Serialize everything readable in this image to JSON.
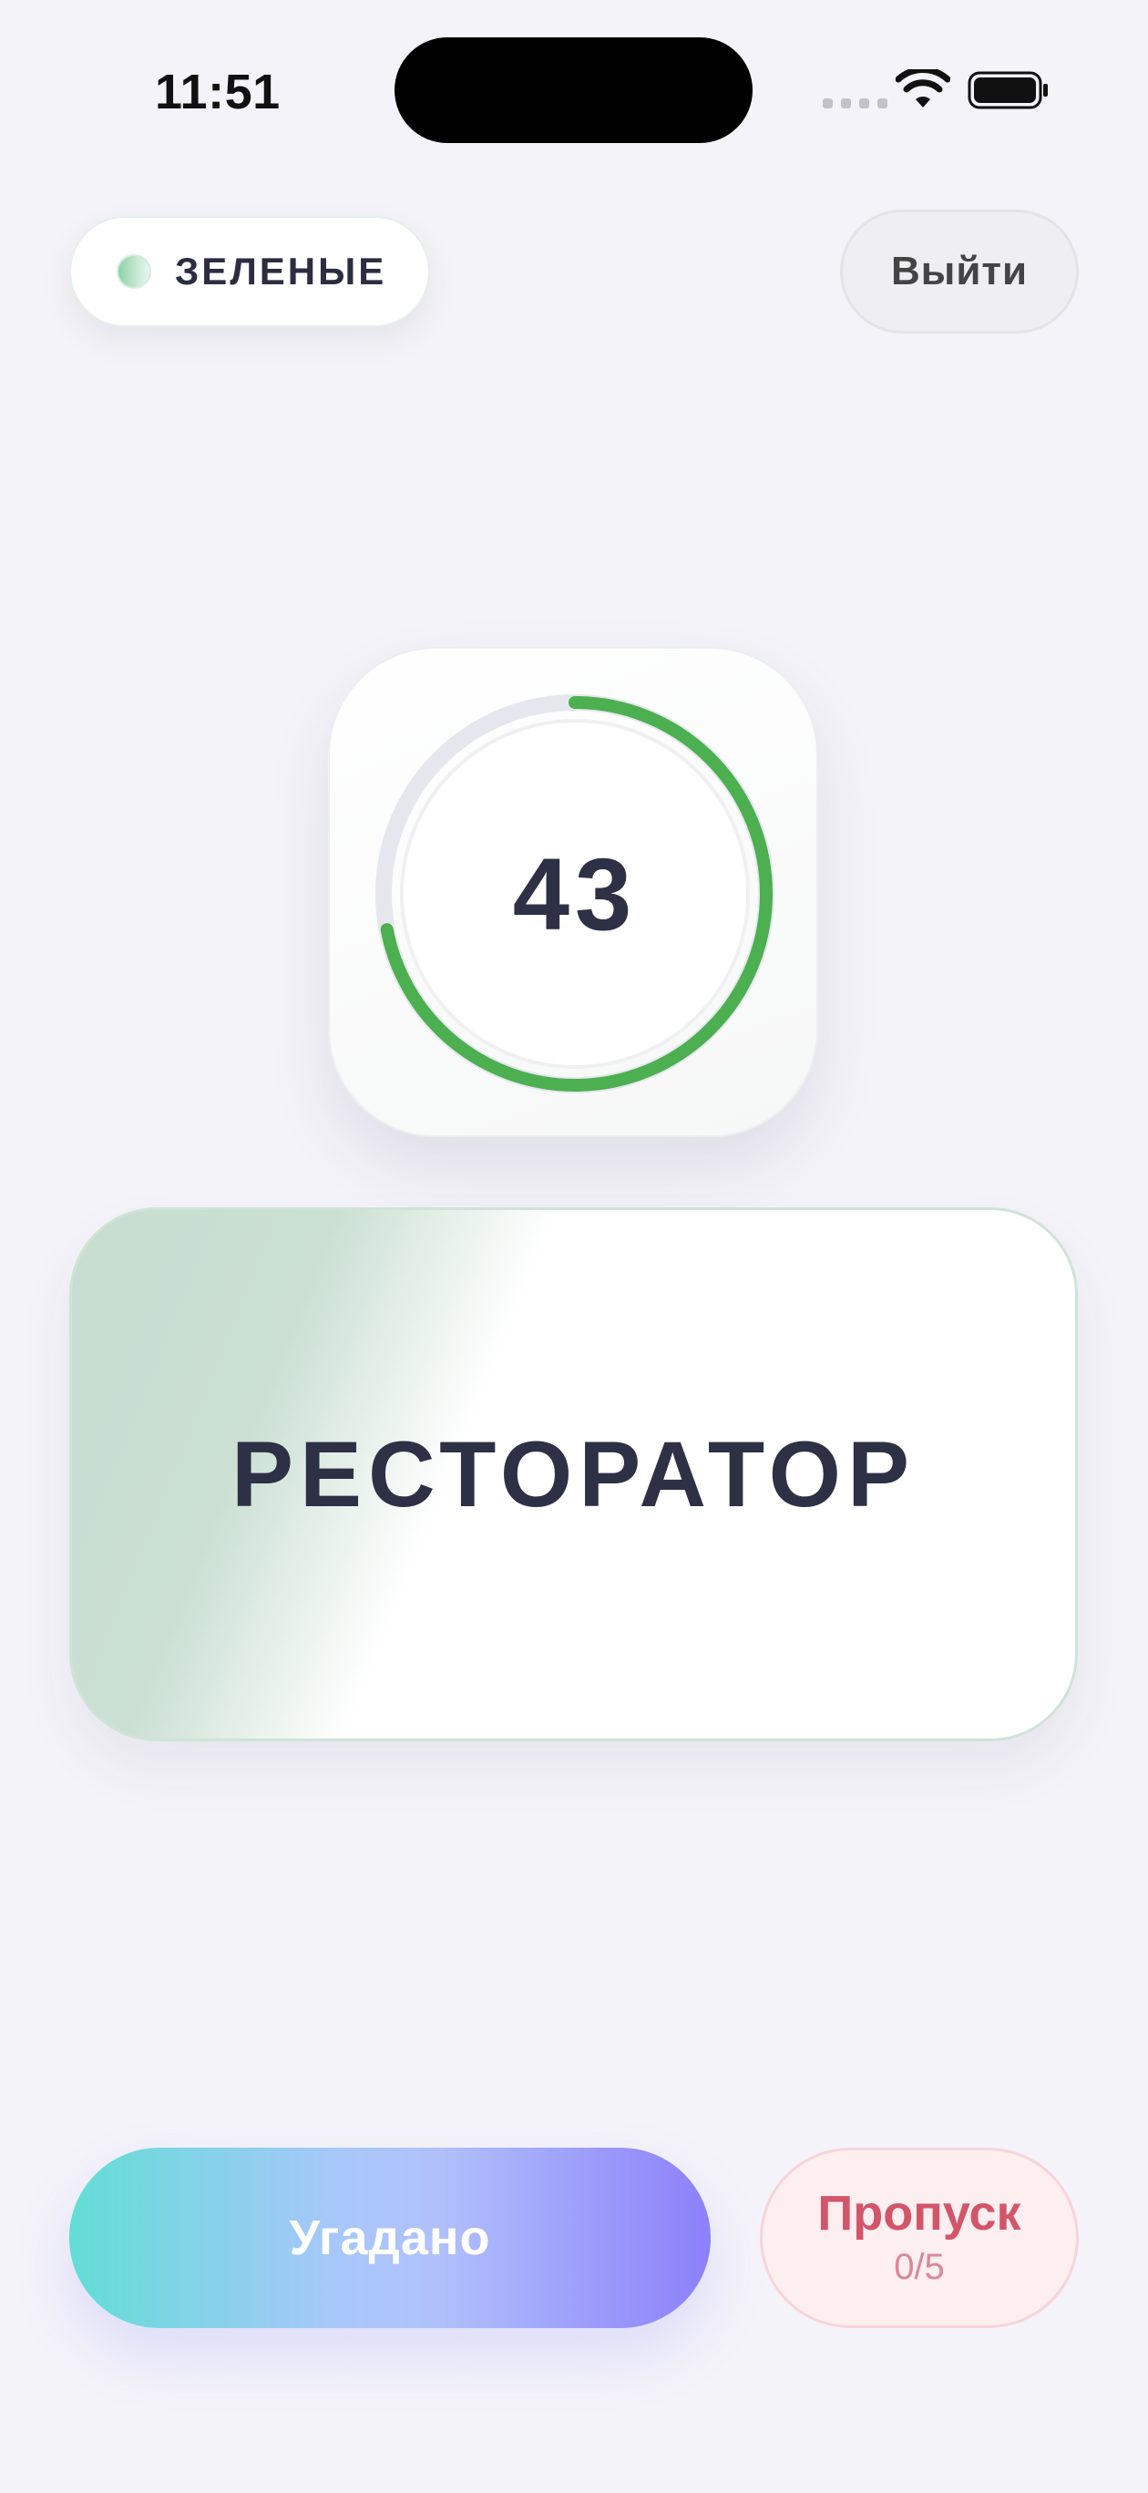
{
  "status_bar": {
    "time": "11:51"
  },
  "header": {
    "team_name": "ЗЕЛЕНЫЕ",
    "exit_label": "Выйти"
  },
  "timer": {
    "seconds_left": "43",
    "progress_fraction": 0.72,
    "ring_color": "#4caf50",
    "track_color": "#e6e7ee"
  },
  "word_card": {
    "word": "РЕСТОРАТОР"
  },
  "actions": {
    "guessed_label": "Угадано",
    "skip_label": "Пропуск",
    "skip_count": "0/5"
  },
  "icons": {
    "signal": "cellular-signal-icon",
    "wifi": "wifi-icon",
    "battery": "battery-icon"
  }
}
